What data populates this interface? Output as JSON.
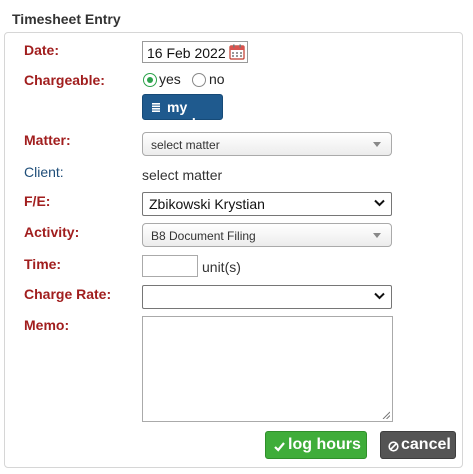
{
  "title": "Timesheet Entry",
  "labels": {
    "date": "Date:",
    "chargeable": "Chargeable:",
    "matter": "Matter:",
    "client": "Client:",
    "fe": "F/E:",
    "activity": "Activity:",
    "time": "Time:",
    "charge_rate": "Charge Rate:",
    "memo": "Memo:"
  },
  "date": {
    "value": "16 Feb 2022",
    "icon": "calendar-icon"
  },
  "chargeable": {
    "yes_label": "yes",
    "no_label": "no",
    "selected": "yes"
  },
  "my_work_button": {
    "label": "my work",
    "icon": "list-icon"
  },
  "matter": {
    "value": "select matter"
  },
  "client": {
    "value": "select matter"
  },
  "fe": {
    "value": "Zbikowski Krystian"
  },
  "activity": {
    "value": "B8 Document Filing"
  },
  "time": {
    "value": "",
    "unit": "unit(s)"
  },
  "charge_rate": {
    "value": ""
  },
  "memo": {
    "value": ""
  },
  "buttons": {
    "log_hours": "log hours",
    "cancel": "cancel"
  },
  "colors": {
    "label_red": "#a11e1e",
    "client_blue": "#1f4e79",
    "primary_blue": "#1f5a8e",
    "success_green": "#3fad3a",
    "cancel_gray": "#545454",
    "radio_green": "#2ca24b"
  }
}
